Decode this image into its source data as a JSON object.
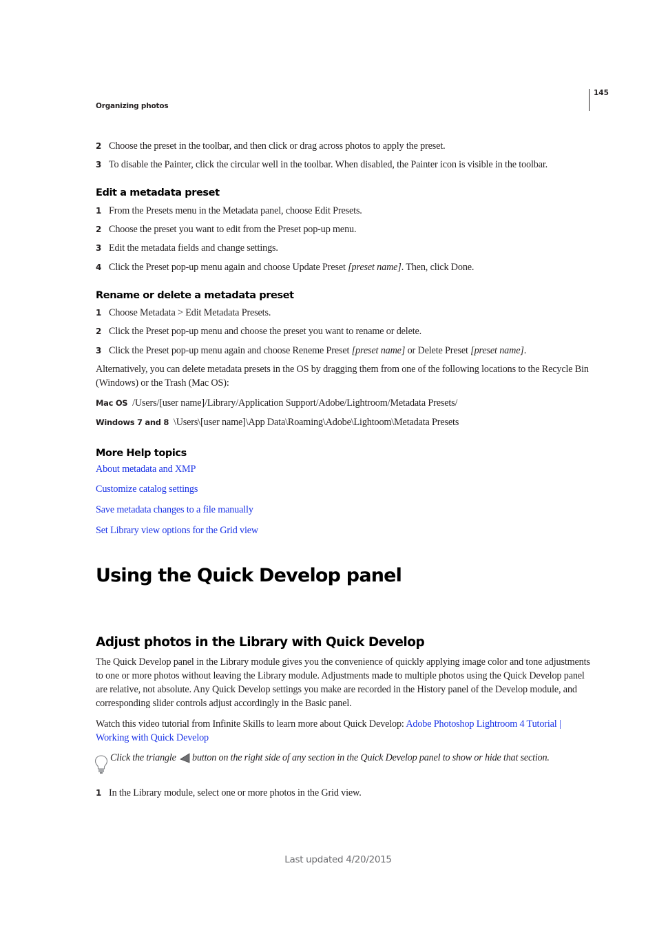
{
  "header": {
    "section_title": "Organizing photos",
    "page_number": "145"
  },
  "painter_steps": [
    {
      "num": "2",
      "text": "Choose the preset in the toolbar, and then click or drag across photos to apply the preset."
    },
    {
      "num": "3",
      "text": "To disable the Painter, click the circular well in the toolbar. When disabled, the Painter icon is visible in the toolbar."
    }
  ],
  "edit_preset": {
    "heading": "Edit a metadata preset",
    "steps": [
      {
        "num": "1",
        "text": "From the Presets menu in the Metadata panel, choose Edit Presets."
      },
      {
        "num": "2",
        "text": "Choose the preset you want to edit from the Preset pop-up menu."
      },
      {
        "num": "3",
        "text": "Edit the metadata fields and change settings."
      },
      {
        "num": "4",
        "text_before": "Click the Preset pop-up menu again and choose Update Preset ",
        "italic": "[preset name]",
        "text_after": ". Then, click Done."
      }
    ]
  },
  "rename_preset": {
    "heading": "Rename or delete a metadata preset",
    "steps": [
      {
        "num": "1",
        "text": "Choose Metadata > Edit Metadata Presets."
      },
      {
        "num": "2",
        "text": "Click the Preset pop-up menu and choose the preset you want to rename or delete."
      },
      {
        "num": "3",
        "text_before": "Click the Preset pop-up menu again and choose Reneme Preset ",
        "italic1": "[preset name]",
        "text_middle": " or Delete Preset ",
        "italic2": "[preset name]",
        "text_after": "."
      }
    ],
    "alternative_text": "Alternatively, you can delete metadata presets in the OS by dragging them from one of the following locations to the Recycle Bin (Windows) or the Trash (Mac OS):",
    "locations": [
      {
        "label": "Mac OS",
        "path": "/Users/[user name]/Library/Application Support/Adobe/Lightroom/Metadata Presets/"
      },
      {
        "label": "Windows 7 and 8",
        "path": "\\Users\\[user name]\\App Data\\Roaming\\Adobe\\Lightoom\\Metadata Presets"
      }
    ]
  },
  "more_help": {
    "heading": "More Help topics",
    "links": [
      "About metadata and XMP",
      "Customize catalog settings",
      "Save metadata changes to a file manually",
      "Set Library view options for the Grid view"
    ]
  },
  "quick_develop": {
    "title": "Using the Quick Develop panel",
    "subtitle": "Adjust photos in the Library with Quick Develop",
    "intro": "The Quick Develop panel in the Library module gives you the convenience of quickly applying image color and tone adjustments to one or more photos without leaving the Library module. Adjustments made to multiple photos using the Quick Develop panel are relative, not absolute. Any Quick Develop settings you make are recorded in the History panel of the Develop module, and corresponding slider controls adjust accordingly in the Basic panel.",
    "video_text": "Watch this video tutorial from Infinite Skills to learn more about Quick Develop: ",
    "video_link": "Adobe Photoshop Lightroom 4 Tutorial | Working with Quick Develop",
    "tip_before": "Click the triangle ",
    "tip_after": "button on the right side of any section in the Quick Develop panel to show or hide that section.",
    "steps": [
      {
        "num": "1",
        "text": "In the Library module, select one or more photos in the Grid view."
      }
    ]
  },
  "footer": {
    "last_updated": "Last updated 4/20/2015"
  },
  "colors": {
    "link": "#1a33e6",
    "text": "#231f20",
    "footer": "#6d6e71"
  }
}
